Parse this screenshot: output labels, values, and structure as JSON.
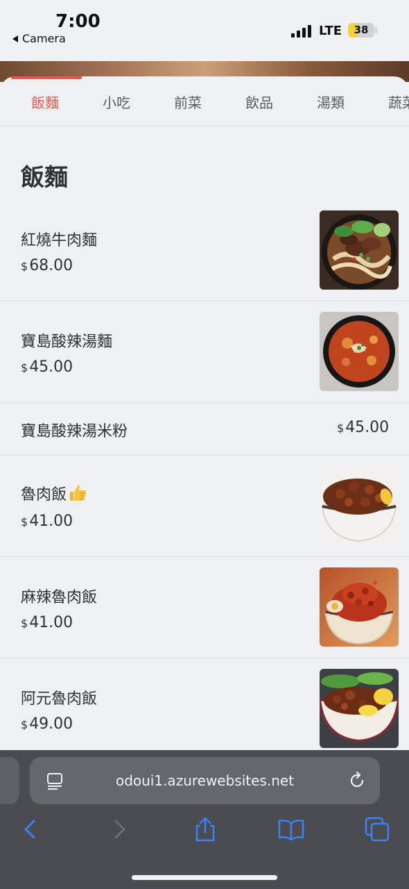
{
  "status_bar": {
    "time": "7:00",
    "back_label": "Camera",
    "network": "LTE",
    "battery": "38",
    "battery_level": 0.38,
    "colors": {
      "battery": "#f4d13d"
    }
  },
  "tabs": [
    {
      "label": "飯麵",
      "active": true
    },
    {
      "label": "小吃",
      "active": false
    },
    {
      "label": "前菜",
      "active": false
    },
    {
      "label": "飲品",
      "active": false
    },
    {
      "label": "湯類",
      "active": false
    },
    {
      "label": "蔬菜",
      "active": false
    }
  ],
  "section": {
    "title": "飯麵"
  },
  "menu_items": [
    {
      "name": "紅燒牛肉麵",
      "currency": "$",
      "price": "68.00",
      "photo": "beef-noodle-soup-photo"
    },
    {
      "name": "寶島酸辣湯麵",
      "currency": "$",
      "price": "45.00",
      "photo": "hot-sour-noodle-soup-photo"
    },
    {
      "name": "寶島酸辣湯米粉",
      "currency": "$",
      "price": "45.00",
      "photo": null
    },
    {
      "name": "魯肉飯",
      "currency": "$",
      "price": "41.00",
      "photo": "braised-pork-rice-photo",
      "badge_icon": "thumbs-up-icon"
    },
    {
      "name": "麻辣魯肉飯",
      "currency": "$",
      "price": "41.00",
      "photo": "spicy-braised-pork-rice-photo"
    },
    {
      "name": "阿元魯肉飯",
      "currency": "$",
      "price": "49.00",
      "photo": "ayuan-braised-pork-rice-photo"
    }
  ],
  "browser": {
    "url": "odoui1.azurewebsites.net",
    "icons": [
      "page-format-icon",
      "reload-icon",
      "back-icon",
      "forward-icon",
      "share-icon",
      "bookmarks-icon",
      "tabs-icon"
    ]
  },
  "colors": {
    "accent": "#e8584f",
    "ios_blue": "#3b82f6"
  }
}
